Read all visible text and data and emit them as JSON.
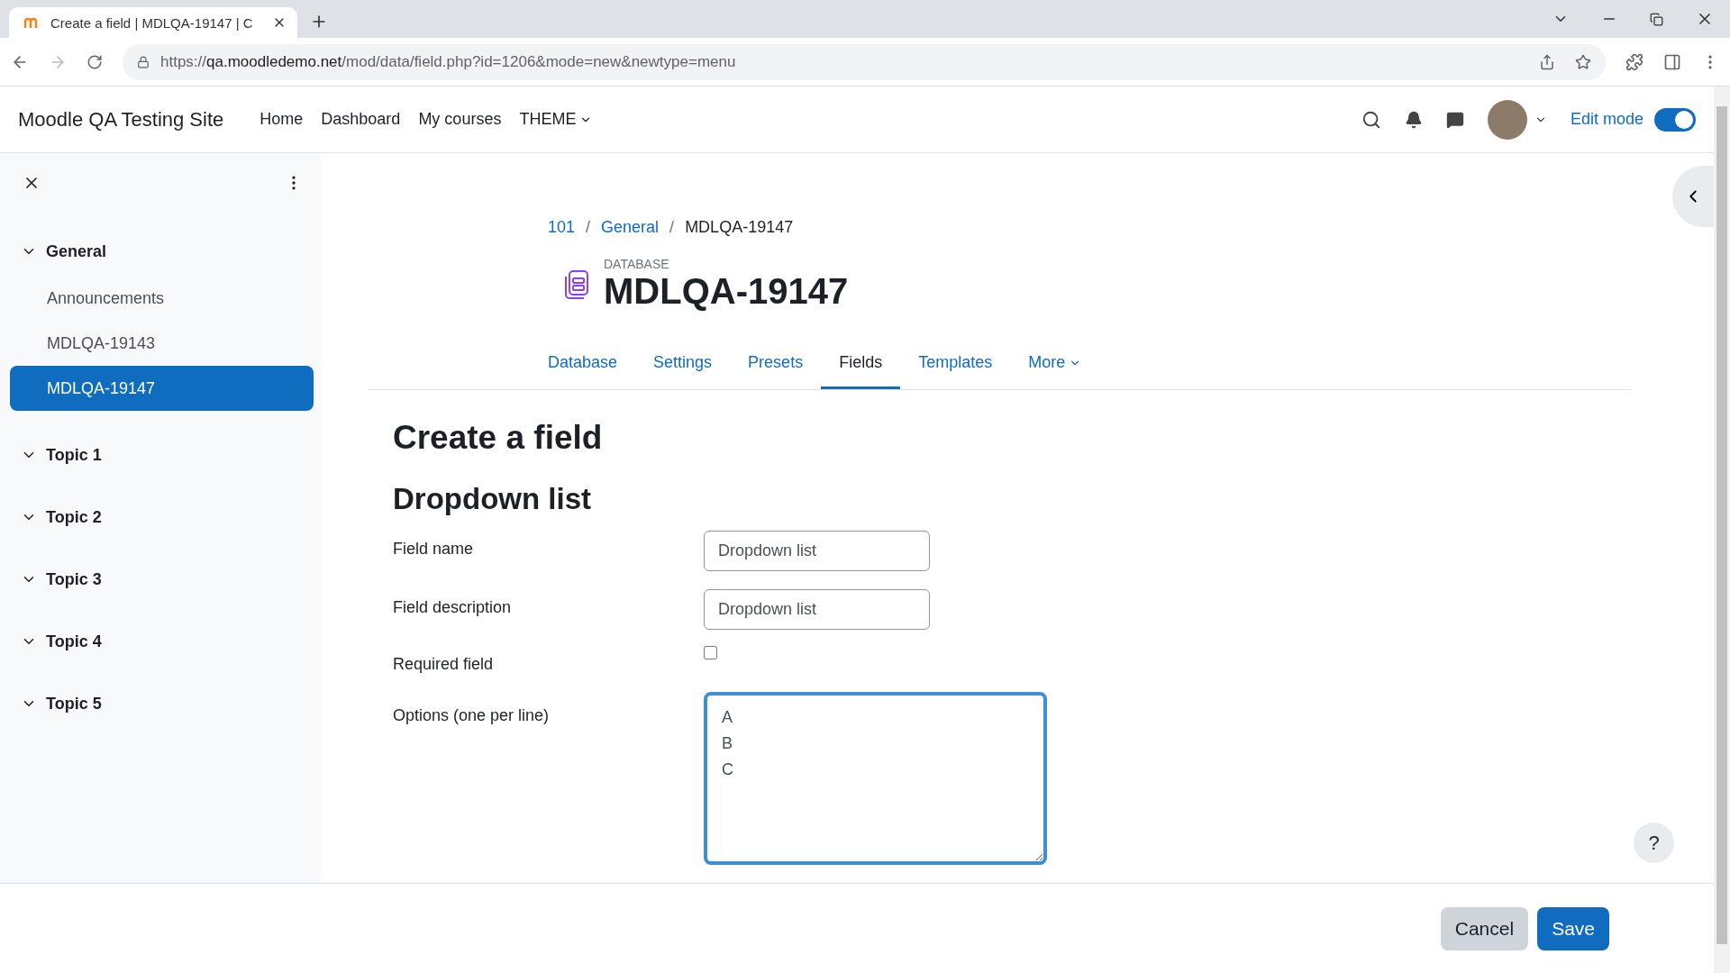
{
  "browser": {
    "tab_title": "Create a field | MDLQA-19147 | C",
    "url": {
      "scheme": "https://",
      "host": "qa.moodledemo.net",
      "path": "/mod/data/field.php?id=1206&mode=new&newtype=menu"
    }
  },
  "navbar": {
    "site_name": "Moodle QA Testing Site",
    "links": [
      {
        "label": "Home",
        "kind": "link"
      },
      {
        "label": "Dashboard",
        "kind": "link"
      },
      {
        "label": "My courses",
        "kind": "link"
      },
      {
        "label": "THEME",
        "kind": "dropdown"
      }
    ],
    "edit_mode": {
      "label": "Edit mode",
      "on": true
    }
  },
  "sidebar": {
    "items": [
      {
        "label": "General",
        "expanded": true,
        "children": [
          {
            "label": "Announcements",
            "selected": false
          },
          {
            "label": "MDLQA-19143",
            "selected": false
          },
          {
            "label": "MDLQA-19147",
            "selected": true
          }
        ]
      },
      {
        "label": "Topic 1",
        "expanded": true
      },
      {
        "label": "Topic 2",
        "expanded": true
      },
      {
        "label": "Topic 3",
        "expanded": true
      },
      {
        "label": "Topic 4",
        "expanded": true
      },
      {
        "label": "Topic 5",
        "expanded": true
      }
    ]
  },
  "breadcrumb": [
    {
      "label": "101",
      "kind": "link"
    },
    {
      "label": "/",
      "kind": "separator"
    },
    {
      "label": "General",
      "kind": "link"
    },
    {
      "label": "/",
      "kind": "separator"
    },
    {
      "label": "MDLQA-19147",
      "kind": "current"
    }
  ],
  "activity": {
    "type_label": "DATABASE",
    "title": "MDLQA-19147"
  },
  "tabs": [
    {
      "label": "Database",
      "selected": false,
      "kind": "tab"
    },
    {
      "label": "Settings",
      "selected": false,
      "kind": "tab"
    },
    {
      "label": "Presets",
      "selected": false,
      "kind": "tab"
    },
    {
      "label": "Fields",
      "selected": true,
      "kind": "tab"
    },
    {
      "label": "Templates",
      "selected": false,
      "kind": "tab"
    },
    {
      "label": "More",
      "selected": false,
      "kind": "dropdown"
    }
  ],
  "heading": "Create a field",
  "subheading": "Dropdown list",
  "form": [
    {
      "label": "Field name",
      "kind": "text",
      "value": "Dropdown list"
    },
    {
      "label": "Field description",
      "kind": "text",
      "value": "Dropdown list"
    },
    {
      "label": "Required field",
      "kind": "checkbox",
      "checked": false
    },
    {
      "label": "Options (one per line)",
      "kind": "textarea",
      "value": "A\nB\nC",
      "focused": true
    }
  ],
  "help": "?",
  "footer_buttons": [
    {
      "label": "Cancel",
      "kind": "secondary"
    },
    {
      "label": "Save",
      "kind": "primary"
    }
  ]
}
